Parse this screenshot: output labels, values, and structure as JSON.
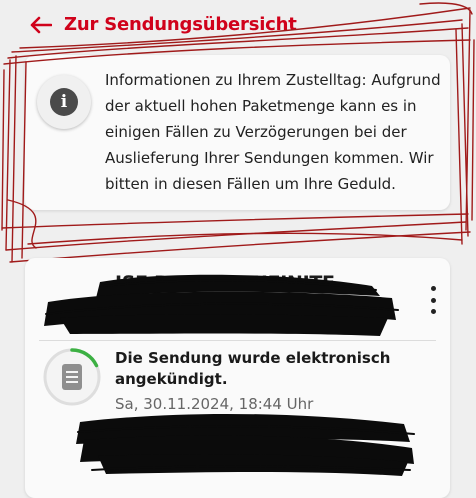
{
  "nav": {
    "back_label": "Zur Sendungsübersicht",
    "back_icon": "arrow-left-icon"
  },
  "info": {
    "icon": "info-icon",
    "icon_glyph": "i",
    "message": "Informationen zu Ihrem Zustelltag: Aufgrund der aktuell hohen Paketmenge kann es in einigen Fällen zu Verzögerungen bei der Auslieferung Ihrer Sendungen kommen. Wir bitten in diesen Fällen um Ihre Geduld."
  },
  "shipment": {
    "title": "ISE RETURN INFINITE",
    "menu_icon": "more-vertical-icon",
    "status": {
      "icon": "document-icon",
      "text": "Die Sendung wurde elektronisch angekündigt.",
      "date": "Sa, 30.11.2024, 18:44 Uhr",
      "progress": 0.18
    }
  },
  "colors": {
    "accent": "#d0021b",
    "scribble": "#a01a1a",
    "progress": "#3cb043",
    "redaction": "#0b0b0b"
  }
}
